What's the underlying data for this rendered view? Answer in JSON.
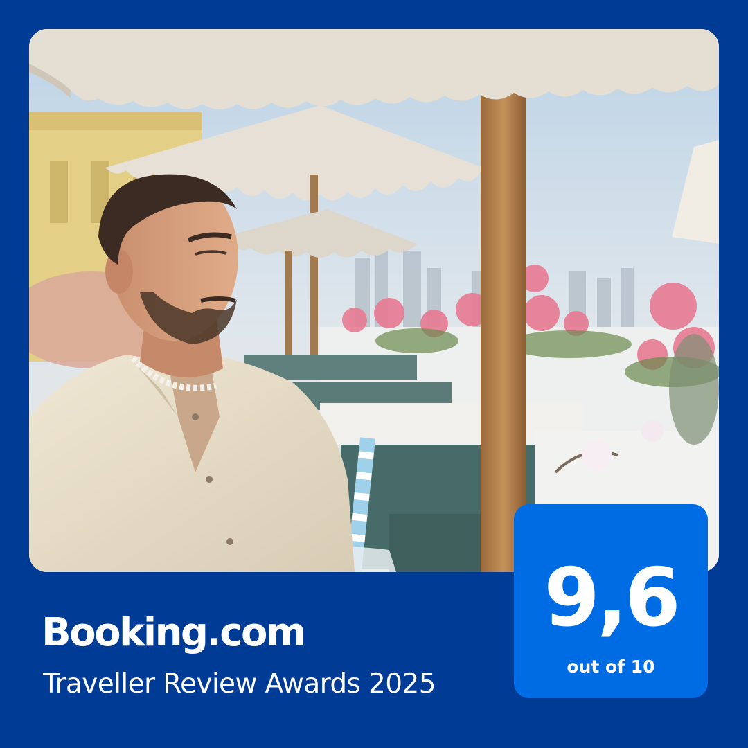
{
  "brand": {
    "name": "Booking.com",
    "award": "Traveller Review Awards 2025",
    "background_color": "#003b95",
    "accent_color": "#006ce4"
  },
  "score": {
    "value": "9,6",
    "caption": "out of 10"
  },
  "photo": {
    "subject": "man-on-rooftop-terrace"
  }
}
